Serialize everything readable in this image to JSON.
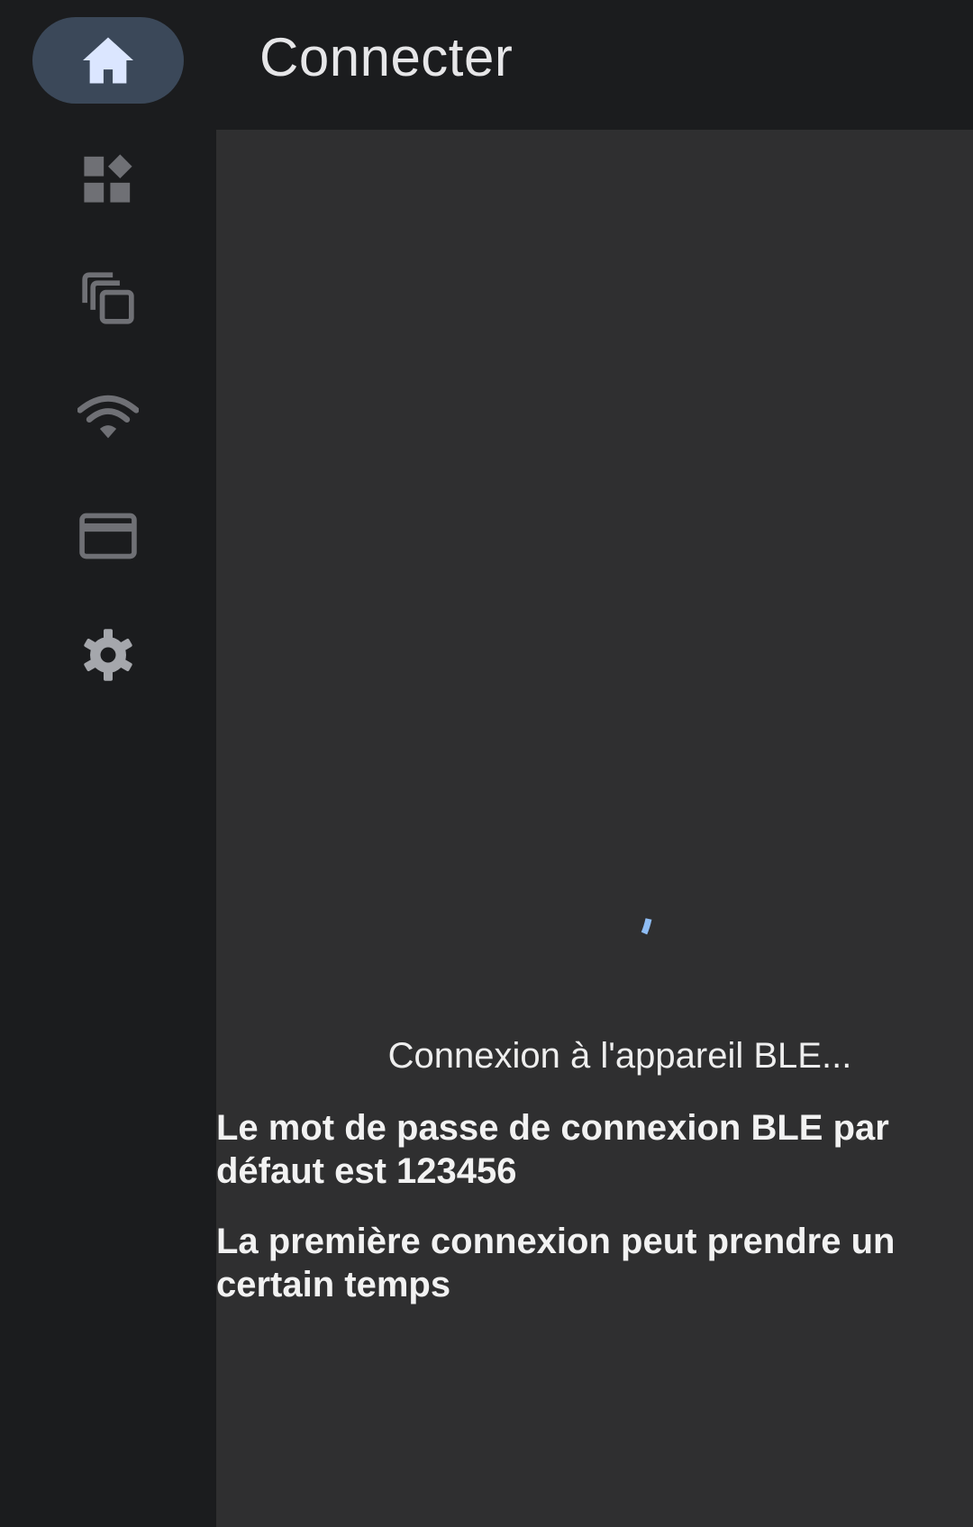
{
  "header": {
    "title": "Connecter"
  },
  "nav": {
    "items": [
      {
        "icon": "home-icon",
        "active": true
      },
      {
        "icon": "widgets-icon",
        "active": false
      },
      {
        "icon": "copy-icon",
        "active": false
      },
      {
        "icon": "wifi-icon",
        "active": false
      },
      {
        "icon": "card-icon",
        "active": false
      },
      {
        "icon": "gear-icon",
        "active": false
      }
    ]
  },
  "connection": {
    "status": "Connexion à l'appareil BLE...",
    "hint_password": "Le mot de passe de connexion BLE par défaut est 123456",
    "hint_time": "La première connexion peut prendre un certain temps"
  },
  "colors": {
    "background": "#1b1c1e",
    "content": "#2f2f30",
    "active_pill": "#3b4859",
    "active_icon": "#dbe6ff",
    "inactive_icon": "#6f7075",
    "spinner": "#8fbdf5"
  }
}
